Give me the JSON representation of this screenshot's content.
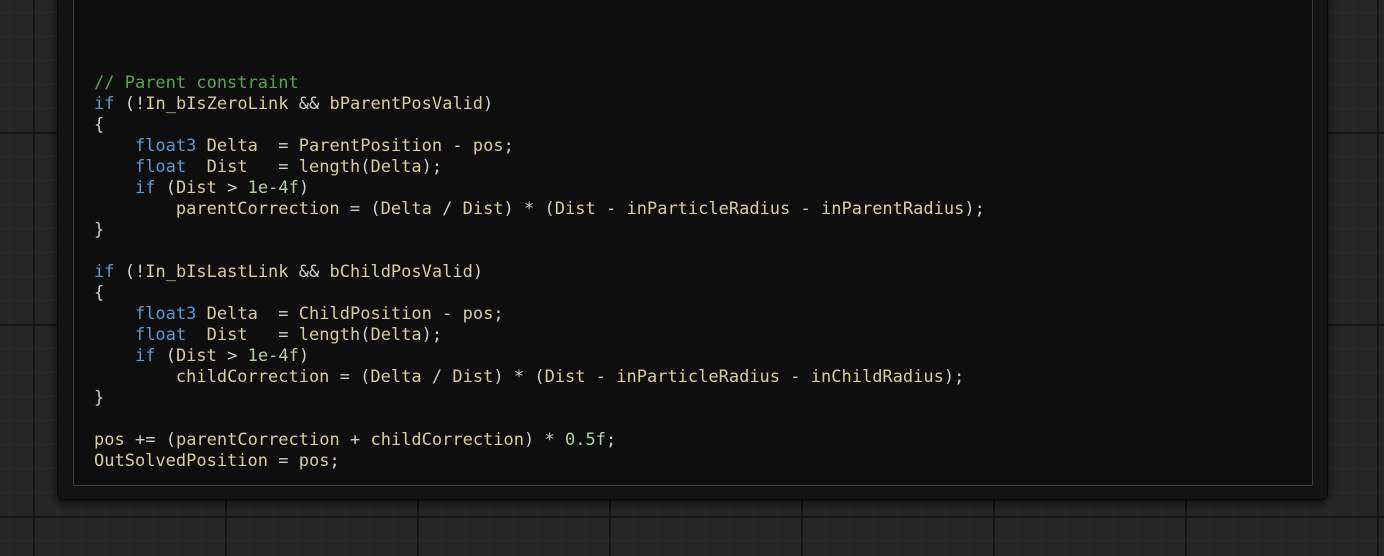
{
  "editor": {
    "lines": [
      "// Parent constraint",
      "if (!In_bIsZeroLink && bParentPosValid)",
      "{",
      "    float3 Delta  = ParentPosition - pos;",
      "    float  Dist   = length(Delta);",
      "    if (Dist > 1e-4f)",
      "        parentCorrection = (Delta / Dist) * (Dist - inParticleRadius - inParentRadius);",
      "}",
      "",
      "if (!In_bIsLastLink && bChildPosValid)",
      "{",
      "    float3 Delta  = ChildPosition - pos;",
      "    float  Dist   = length(Delta);",
      "    if (Dist > 1e-4f)",
      "        childCorrection = (Delta / Dist) * (Dist - inParticleRadius - inChildRadius);",
      "}",
      "",
      "pos += (parentCorrection + childCorrection) * 0.5f;",
      "OutSolvedPosition = pos;"
    ]
  },
  "colors": {
    "comment": "#57a64a",
    "keyword": "#569cd6",
    "identifier": "#d7ce9a",
    "operator": "#cfcfcf",
    "number": "#b5cea8",
    "panel_background": "#0e0e0e",
    "graph_background": "#262626"
  }
}
